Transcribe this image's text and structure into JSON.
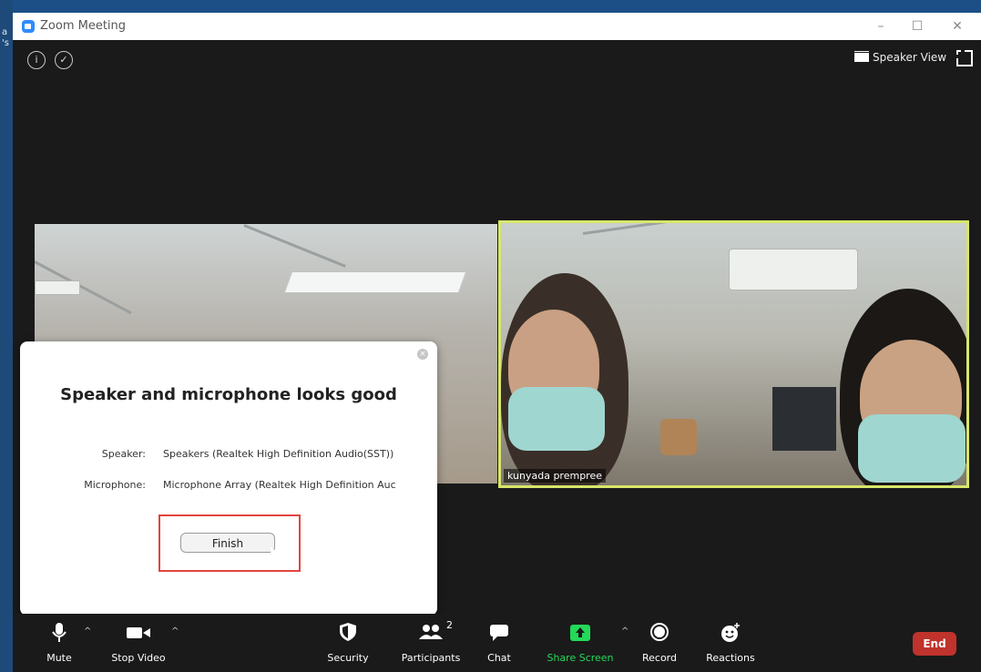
{
  "desktop": {
    "edge_chars": [
      "a",
      "'s"
    ]
  },
  "window": {
    "title": "Zoom Meeting",
    "controls": {
      "minimize": "–",
      "maximize": "☐",
      "close": "✕"
    }
  },
  "top": {
    "speaker_view_label": "Speaker View"
  },
  "videos": {
    "right_participant_name": "kunyada prempree"
  },
  "dialog": {
    "title": "Speaker and microphone looks good",
    "speaker_label": "Speaker:",
    "speaker_value": "Speakers (Realtek High Definition Audio(SST))",
    "microphone_label": "Microphone:",
    "microphone_value": "Microphone Array (Realtek High Definition Auc",
    "finish_label": "Finish"
  },
  "toolbar": {
    "mute_label": "Mute",
    "stop_video_label": "Stop Video",
    "security_label": "Security",
    "participants_label": "Participants",
    "participants_count": "2",
    "chat_label": "Chat",
    "share_screen_label": "Share Screen",
    "record_label": "Record",
    "reactions_label": "Reactions",
    "end_label": "End"
  },
  "colors": {
    "share_green": "#23d959",
    "end_red": "#c0322c",
    "active_border": "#d8e66a",
    "highlight_red": "#e0453f"
  }
}
